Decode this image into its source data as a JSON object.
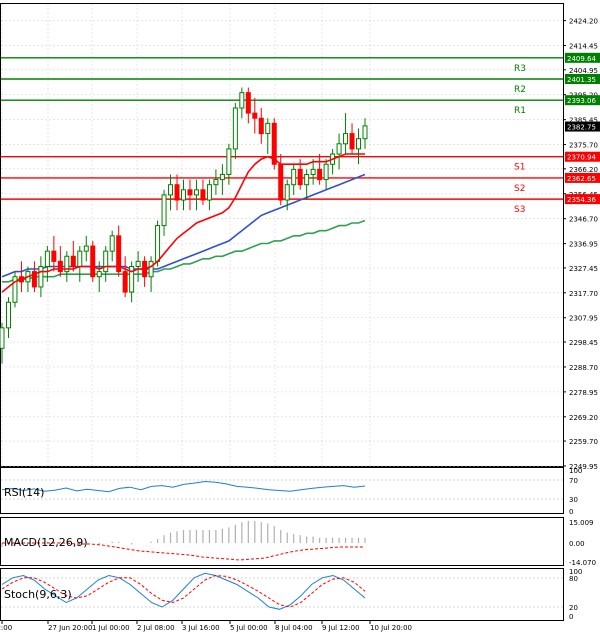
{
  "chart_data": {
    "type": "candlestick",
    "symbol_hidden": true,
    "y_ticks": [
      "2424.20",
      "2414.45",
      "2404.95",
      "2395.20",
      "2385.45",
      "2375.70",
      "2366.20",
      "2356.45",
      "2346.70",
      "2336.95",
      "2327.45",
      "2317.70",
      "2307.95",
      "2298.45",
      "2288.70",
      "2278.95",
      "2269.20",
      "2259.70",
      "2249.95"
    ],
    "ylim": [
      2249.95,
      2430.3
    ],
    "x_tick_labels": [
      "12:00",
      "27 Jun 20:00",
      "1 Jul 00:00",
      "2 Jul 08:00",
      "3 Jul 16:00",
      "5 Jul 00:00",
      "8 Jul 04:00",
      "9 Jul 12:00",
      "10 Jul 20:00"
    ],
    "levels": [
      {
        "name": "R3",
        "value": 2409.64,
        "label": "2409.64",
        "color": "#008000"
      },
      {
        "name": "R2",
        "value": 2401.35,
        "label": "2401.35",
        "color": "#008000"
      },
      {
        "name": "R1",
        "value": 2393.06,
        "label": "2393.06",
        "color": "#008000"
      },
      {
        "name": "S1",
        "value": 2370.94,
        "label": "2370.94",
        "color": "#ff0000"
      },
      {
        "name": "S2",
        "value": 2362.65,
        "label": "2362.65",
        "color": "#ff0000"
      },
      {
        "name": "S3",
        "value": 2354.36,
        "label": "2354.36",
        "color": "#ff0000"
      }
    ],
    "current_price": {
      "value": 2382.75,
      "label": "2382.75"
    },
    "candles": [
      [
        2296,
        2306,
        2290,
        2304
      ],
      [
        2304,
        2316,
        2300,
        2314
      ],
      [
        2314,
        2326,
        2312,
        2324
      ],
      [
        2324,
        2330,
        2318,
        2322
      ],
      [
        2322,
        2328,
        2318,
        2326
      ],
      [
        2326,
        2330,
        2318,
        2320
      ],
      [
        2320,
        2332,
        2316,
        2328
      ],
      [
        2328,
        2336,
        2322,
        2334
      ],
      [
        2334,
        2340,
        2326,
        2330
      ],
      [
        2330,
        2336,
        2324,
        2326
      ],
      [
        2326,
        2334,
        2322,
        2332
      ],
      [
        2332,
        2338,
        2326,
        2328
      ],
      [
        2328,
        2336,
        2322,
        2334
      ],
      [
        2334,
        2340,
        2330,
        2336
      ],
      [
        2336,
        2338,
        2322,
        2324
      ],
      [
        2324,
        2330,
        2318,
        2326
      ],
      [
        2326,
        2336,
        2322,
        2334
      ],
      [
        2334,
        2342,
        2330,
        2340
      ],
      [
        2340,
        2344,
        2324,
        2326
      ],
      [
        2326,
        2332,
        2316,
        2318
      ],
      [
        2318,
        2330,
        2314,
        2328
      ],
      [
        2328,
        2334,
        2322,
        2330
      ],
      [
        2330,
        2332,
        2320,
        2324
      ],
      [
        2324,
        2332,
        2318,
        2330
      ],
      [
        2330,
        2346,
        2328,
        2344
      ],
      [
        2344,
        2358,
        2340,
        2356
      ],
      [
        2356,
        2364,
        2350,
        2360
      ],
      [
        2360,
        2364,
        2350,
        2354
      ],
      [
        2354,
        2362,
        2350,
        2358
      ],
      [
        2358,
        2362,
        2350,
        2356
      ],
      [
        2356,
        2362,
        2350,
        2358
      ],
      [
        2358,
        2362,
        2352,
        2354
      ],
      [
        2354,
        2362,
        2350,
        2360
      ],
      [
        2360,
        2366,
        2356,
        2362
      ],
      [
        2362,
        2368,
        2356,
        2364
      ],
      [
        2364,
        2376,
        2360,
        2374
      ],
      [
        2374,
        2392,
        2370,
        2390
      ],
      [
        2390,
        2398,
        2386,
        2396
      ],
      [
        2396,
        2398,
        2384,
        2388
      ],
      [
        2388,
        2394,
        2380,
        2386
      ],
      [
        2386,
        2390,
        2376,
        2380
      ],
      [
        2380,
        2386,
        2372,
        2384
      ],
      [
        2384,
        2386,
        2366,
        2368
      ],
      [
        2368,
        2372,
        2352,
        2354
      ],
      [
        2354,
        2362,
        2350,
        2360
      ],
      [
        2360,
        2368,
        2356,
        2366
      ],
      [
        2366,
        2370,
        2358,
        2360
      ],
      [
        2360,
        2366,
        2354,
        2364
      ],
      [
        2364,
        2370,
        2360,
        2366
      ],
      [
        2366,
        2372,
        2360,
        2362
      ],
      [
        2362,
        2370,
        2358,
        2368
      ],
      [
        2368,
        2374,
        2364,
        2372
      ],
      [
        2372,
        2380,
        2366,
        2376
      ],
      [
        2376,
        2388,
        2372,
        2380
      ],
      [
        2380,
        2384,
        2372,
        2374
      ],
      [
        2374,
        2382,
        2368,
        2378
      ],
      [
        2378,
        2386,
        2374,
        2383
      ]
    ],
    "ma_fast": [
      2318,
      2320,
      2322,
      2323,
      2324,
      2325,
      2326,
      2326,
      2327,
      2327,
      2327,
      2327,
      2328,
      2328,
      2328,
      2327,
      2328,
      2328,
      2328,
      2327,
      2326,
      2327,
      2327,
      2328,
      2330,
      2333,
      2336,
      2339,
      2341,
      2343,
      2345,
      2346,
      2347,
      2348,
      2349,
      2351,
      2355,
      2360,
      2365,
      2368,
      2370,
      2371,
      2370,
      2368,
      2368,
      2368,
      2368,
      2368,
      2369,
      2369,
      2369,
      2370,
      2371,
      2372,
      2372,
      2372,
      2372
    ],
    "ma_mid": [
      2324,
      2325,
      2326,
      2326,
      2327,
      2327,
      2327,
      2328,
      2328,
      2328,
      2328,
      2328,
      2328,
      2328,
      2328,
      2328,
      2328,
      2328,
      2328,
      2328,
      2327,
      2327,
      2327,
      2327,
      2327,
      2328,
      2329,
      2330,
      2331,
      2332,
      2333,
      2334,
      2335,
      2336,
      2337,
      2338,
      2340,
      2342,
      2344,
      2346,
      2348,
      2349,
      2350,
      2351,
      2352,
      2353,
      2354,
      2355,
      2356,
      2357,
      2358,
      2359,
      2360,
      2361,
      2362,
      2363,
      2364
    ],
    "ma_slow": [
      2322,
      2322,
      2323,
      2323,
      2323,
      2324,
      2324,
      2324,
      2324,
      2325,
      2325,
      2325,
      2325,
      2325,
      2325,
      2325,
      2325,
      2325,
      2325,
      2325,
      2325,
      2325,
      2325,
      2326,
      2326,
      2327,
      2327,
      2328,
      2329,
      2329,
      2330,
      2331,
      2331,
      2332,
      2332,
      2333,
      2334,
      2334,
      2335,
      2336,
      2337,
      2337,
      2338,
      2338,
      2339,
      2340,
      2340,
      2341,
      2341,
      2342,
      2342,
      2343,
      2344,
      2344,
      2345,
      2345,
      2346
    ],
    "indicators": {
      "rsi": {
        "label": "RSI(14)",
        "ticks": [
          "100",
          "70",
          "30",
          "0"
        ]
      },
      "macd": {
        "label": "MACD(12,26,9)",
        "ticks": [
          "15.009",
          "0.00",
          "-14.070"
        ]
      },
      "stoch": {
        "label": "Stoch(9,6,3)",
        "ticks": [
          "100",
          "80",
          "20",
          "0"
        ]
      }
    },
    "colors": {
      "up": "#008000",
      "down": "#ff0000",
      "ma_fast": "#ff0000",
      "ma_mid": "#3050d0",
      "ma_slow": "#30a050",
      "rsi": "#1f7fd0",
      "macd_signal": "#ff0000",
      "stoch_k": "#1f7fd0",
      "stoch_d": "#ff0000",
      "grid": "#d8d8d8"
    }
  }
}
